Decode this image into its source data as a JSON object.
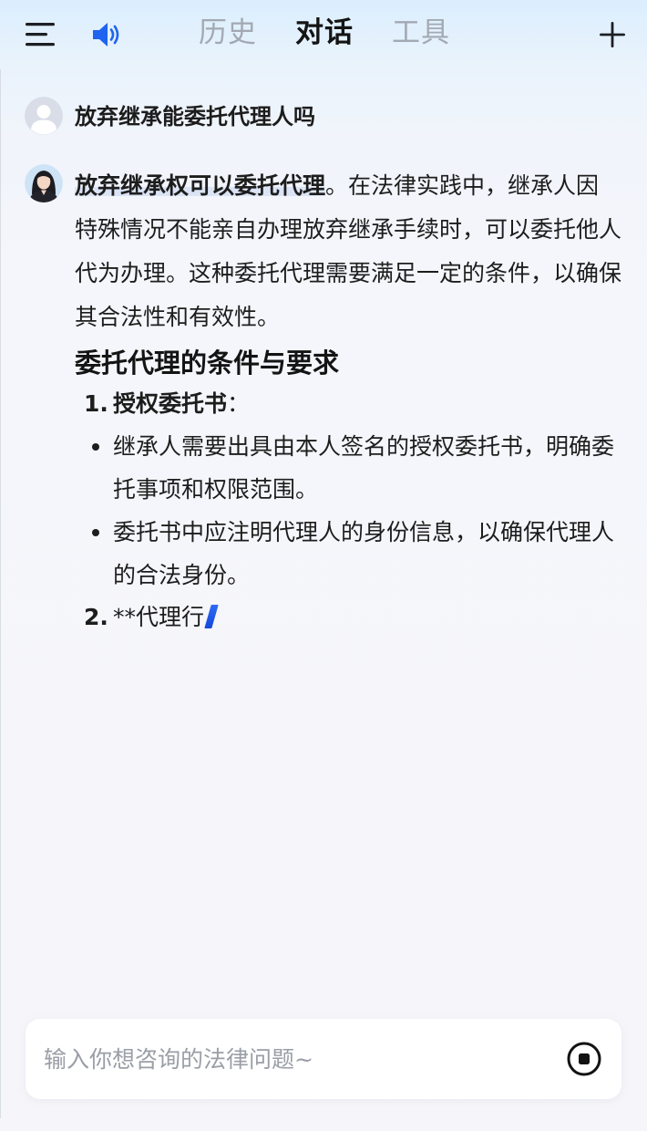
{
  "header": {
    "tabs": [
      {
        "label": "历史",
        "active": false
      },
      {
        "label": "对话",
        "active": true
      },
      {
        "label": "工具",
        "active": false
      }
    ],
    "icons": {
      "menu": "menu-icon",
      "speaker": "speaker-icon",
      "new_chat": "plus-icon"
    },
    "accent_color": "#1f63f0"
  },
  "conversation": {
    "user_message": "放弃继承能委托代理人吗",
    "answer": {
      "highlight": "放弃继承权可以委托代理",
      "intro_rest": "。在法律实践中，继承人因特殊情况不能亲自办理放弃继承手续时，可以委托他人代为办理。这种委托代理需要满足一定的条件，以确保其合法性和有效性。",
      "section_title": "委托代理的条件与要求",
      "item1": {
        "number": "1.",
        "label": "授权委托书",
        "suffix": "：",
        "bullets": [
          "继承人需要出具由本人签名的授权委托书，明确委托事项和权限范围。",
          "委托书中应注明代理人的身份信息，以确保代理人的合法身份。"
        ]
      },
      "item2": {
        "number": "2.",
        "text": "**代理行"
      }
    }
  },
  "input": {
    "placeholder": "输入你想咨询的法律问题~",
    "value": ""
  }
}
